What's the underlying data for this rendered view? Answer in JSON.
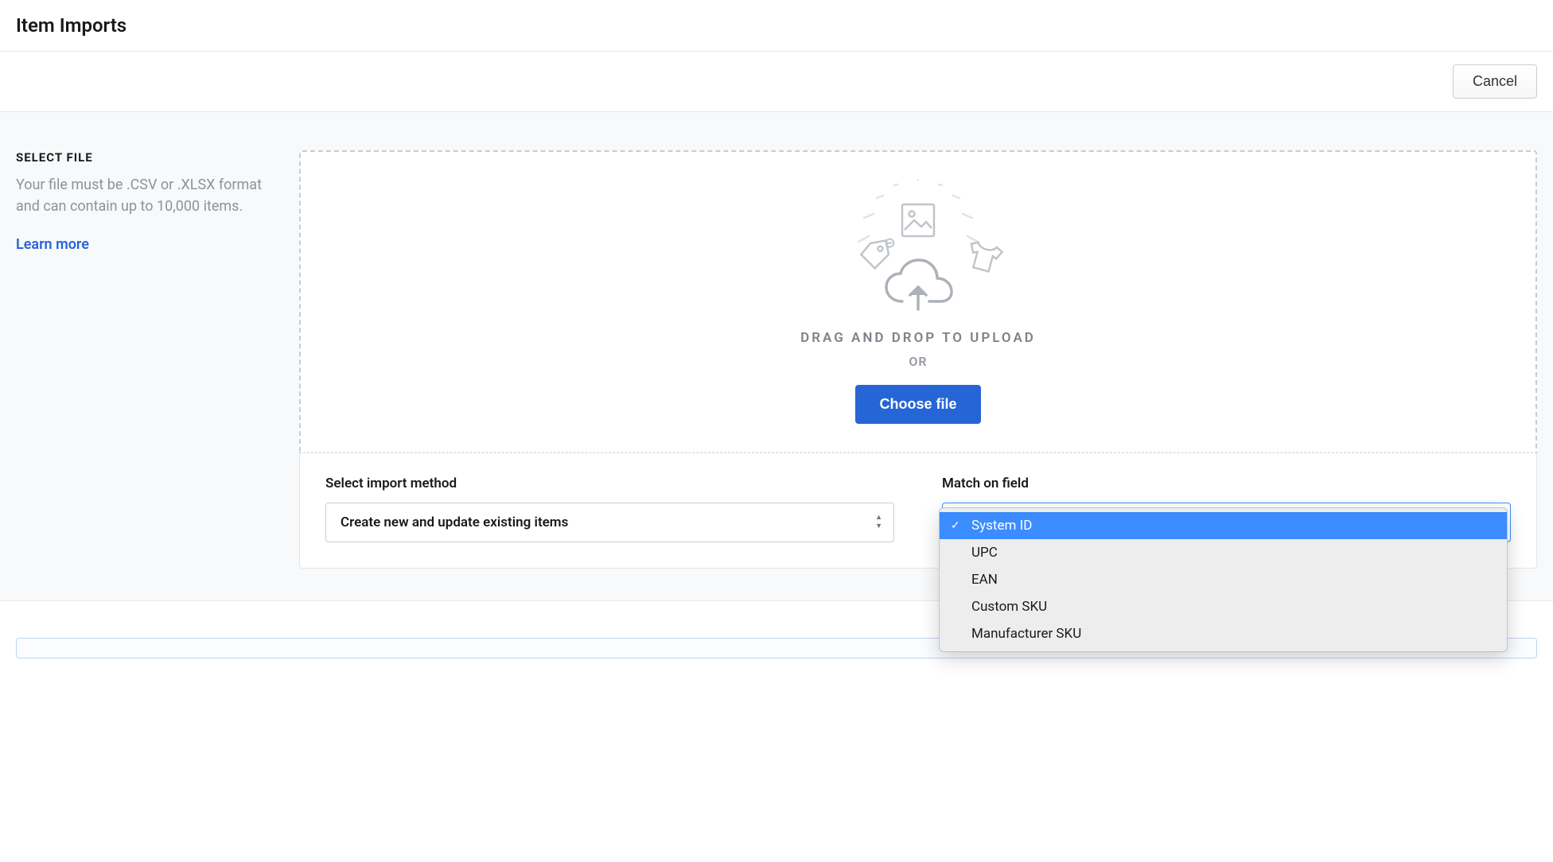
{
  "header": {
    "title": "Item Imports"
  },
  "actionBar": {
    "cancelLabel": "Cancel"
  },
  "leftPanel": {
    "sectionLabel": "SELECT FILE",
    "description": "Your file must be .CSV or .XLSX format and can contain up to 10,000 items.",
    "learnMoreLabel": "Learn more"
  },
  "dropzone": {
    "mainText": "DRAG AND DROP TO UPLOAD",
    "orText": "OR",
    "chooseFileLabel": "Choose file"
  },
  "form": {
    "importMethod": {
      "label": "Select import method",
      "selected": "Create new and update existing items"
    },
    "matchField": {
      "label": "Match on field",
      "options": [
        {
          "label": "System ID",
          "selected": true
        },
        {
          "label": "UPC",
          "selected": false
        },
        {
          "label": "EAN",
          "selected": false
        },
        {
          "label": "Custom SKU",
          "selected": false
        },
        {
          "label": "Manufacturer SKU",
          "selected": false
        }
      ]
    }
  }
}
